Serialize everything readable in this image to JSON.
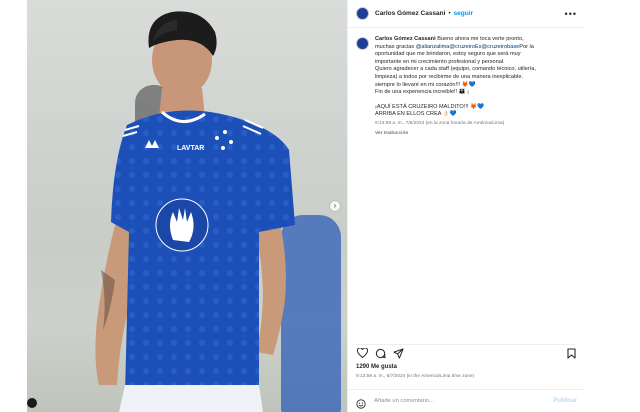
{
  "post": {
    "username": "Carlos Gómez Cassani",
    "separator": "•",
    "follow_label": "seguir",
    "more_label": "•••"
  },
  "caption": {
    "username": "Carlos Gómez Cassani",
    "line1": "Bueno ahora me toca verte pronto,",
    "line2_prefix": "muchas gracias",
    "mention1": "@alianzalima",
    "mention2": "@cruzeiroEs",
    "mention3": "@cruzeirobase",
    "line2_suffix": "Por la",
    "line3": "oportunidad que me brindaron, estoy seguro que será muy",
    "line4": "importante en mi crecimiento profesional y personal.",
    "line5": "Quiero agradecer a cada staff (equipo, comando técnico, utilería,",
    "line6": "limpieza) a todos por recibirme de una manera inexplicable.",
    "line7": "siempre lo llevaré en mi corazón!!! 🦊💙",
    "line8": "Fin de una experiencia increible!! 👨‍👩‍👦 ¡",
    "line9": "¡AQUÍ ESTÁ CRUZEIRO MALDITO!!! 🦊💙",
    "line10": "ARRIBA EN ELLOS CREA 👌🏻💙",
    "timestamp": "9:13:59 a. m., 7/6/2024 (en la zona horaria de América/Lima)",
    "translate_label": "Ver traducción"
  },
  "engagement": {
    "likes": "1290 Me gusta",
    "date": "9:13:59 a. m., 6/7/2024 (in the America/Lima time zone)"
  },
  "comment": {
    "placeholder": "Añade un comentario...",
    "post_label": "Publicar"
  },
  "colors": {
    "accent": "#0095f6",
    "mention": "#00376b",
    "jersey": "#1d4fb8"
  }
}
